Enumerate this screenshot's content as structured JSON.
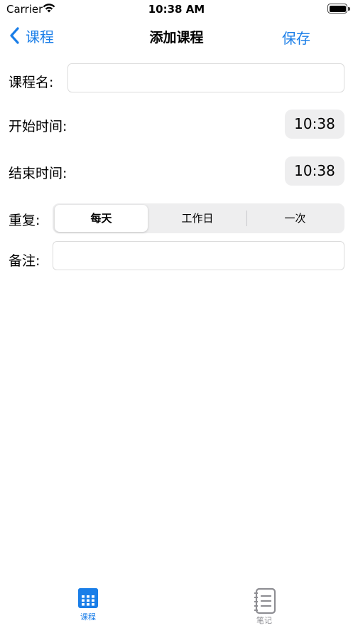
{
  "status_bar": {
    "carrier": "Carrier",
    "time": "10:38 AM",
    "battery_level": 1.0
  },
  "nav": {
    "back_label": "课程",
    "title": "添加课程",
    "save_label": "保存"
  },
  "form": {
    "course_name": {
      "label": "课程名:",
      "value": "",
      "placeholder": ""
    },
    "start_time": {
      "label": "开始时间:",
      "value": "10:38"
    },
    "end_time": {
      "label": "结束时间:",
      "value": "10:38"
    },
    "repeat": {
      "label": "重复:",
      "options": [
        "每天",
        "工作日",
        "一次"
      ],
      "selected": "每天"
    },
    "notes": {
      "label": "备注:",
      "value": "",
      "placeholder": ""
    }
  },
  "tab_bar": {
    "tabs": [
      {
        "label": "课程",
        "icon": "calendar-grid-icon",
        "selected": true
      },
      {
        "label": "笔记",
        "icon": "notebook-icon",
        "selected": false
      }
    ]
  },
  "colors": {
    "accent": "#1a7ee8",
    "inactive": "#8e8e93",
    "control_background": "#eeeeef"
  }
}
